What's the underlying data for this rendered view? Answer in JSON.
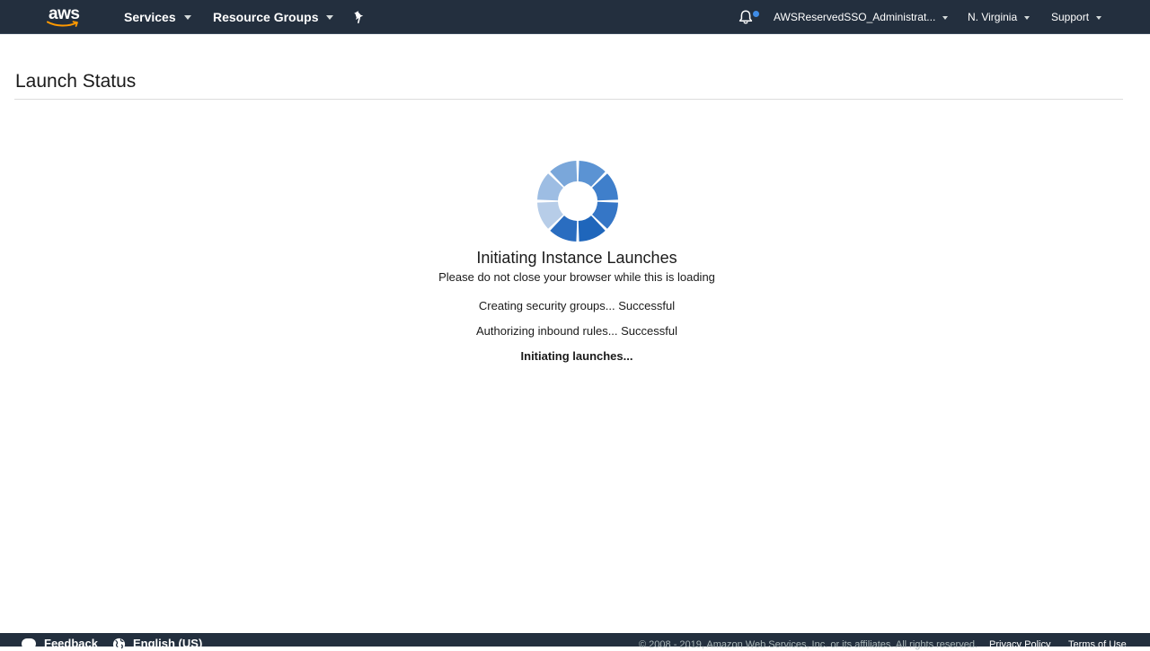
{
  "nav": {
    "logo_text": "aws",
    "services_label": "Services",
    "resource_groups_label": "Resource Groups",
    "account_label": "AWSReservedSSO_Administrat...",
    "region_label": "N. Virginia",
    "support_label": "Support"
  },
  "page": {
    "title": "Launch Status"
  },
  "loading": {
    "title": "Initiating Instance Launches",
    "subtitle": "Please do not close your browser while this is loading",
    "steps": [
      "Creating security groups... Successful",
      "Authorizing inbound rules... Successful",
      "Initiating launches..."
    ]
  },
  "footer": {
    "feedback_label": "Feedback",
    "language_label": "English (US)",
    "copyright": "© 2008 - 2019, Amazon Web Services, Inc. or its affiliates. All rights reserved.",
    "privacy_label": "Privacy Policy",
    "terms_label": "Terms of Use"
  },
  "colors": {
    "nav_background": "#232f3e",
    "spinner_dark": "#1f66bb",
    "spinner_light": "#b7cde8",
    "notification_dot": "#3f8ce6"
  },
  "icons": {
    "pin": "pin-icon",
    "notifications": "bell-icon",
    "feedback": "speech-bubble-icon",
    "language": "globe-icon",
    "loading": "spinner-icon"
  }
}
